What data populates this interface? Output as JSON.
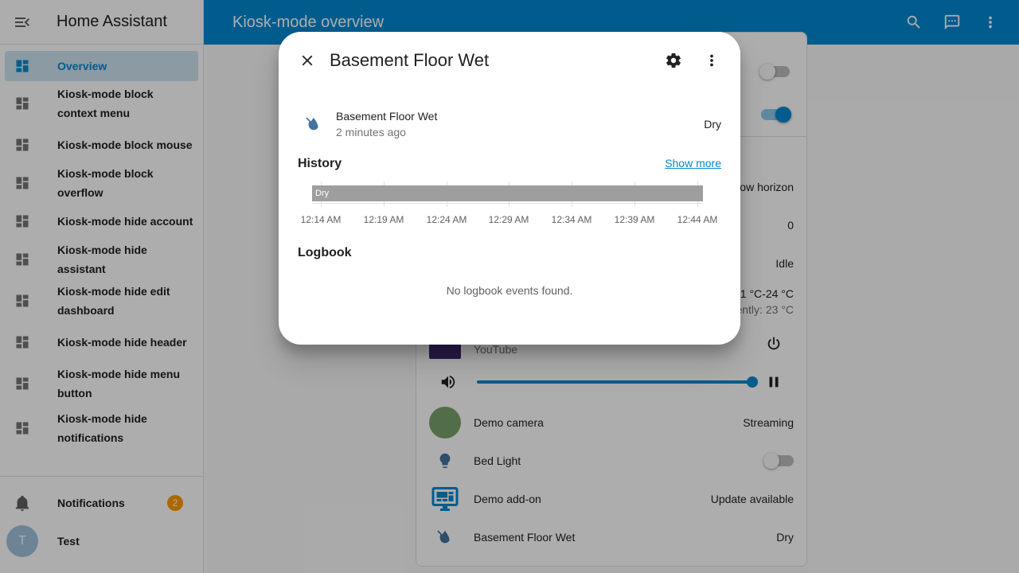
{
  "sidebar": {
    "title": "Home Assistant",
    "items": [
      {
        "label": "Overview",
        "active": true
      },
      {
        "label": "Kiosk-mode block context menu"
      },
      {
        "label": "Kiosk-mode block mouse"
      },
      {
        "label": "Kiosk-mode block overflow"
      },
      {
        "label": "Kiosk-mode hide account"
      },
      {
        "label": "Kiosk-mode hide assistant"
      },
      {
        "label": "Kiosk-mode hide edit dashboard"
      },
      {
        "label": "Kiosk-mode hide header"
      },
      {
        "label": "Kiosk-mode hide menu button"
      },
      {
        "label": "Kiosk-mode hide notifications"
      }
    ],
    "notifications_label": "Notifications",
    "notifications_count": "2",
    "user_initial": "T",
    "user_name": "Test"
  },
  "topbar": {
    "title": "Kiosk-mode overview",
    "icons": [
      "search-icon",
      "assist-icon",
      "more-vert-icon"
    ]
  },
  "card": {
    "partial_row_1": "ow horizon",
    "partial_row_2_value": "0",
    "partial_row_3_value": "Idle",
    "climate_range": "21 °C-24 °C",
    "climate_current": "ently: 23 °C",
    "media_source": "YouTube",
    "camera_label": "Demo camera",
    "camera_state": "Streaming",
    "bed_light_label": "Bed Light",
    "addon_label": "Demo add-on",
    "addon_state": "Update available",
    "sensor_label": "Basement Floor Wet",
    "sensor_state": "Dry"
  },
  "dialog": {
    "title": "Basement Floor Wet",
    "entity_name": "Basement Floor Wet",
    "last_changed": "2 minutes ago",
    "state": "Dry",
    "history_title": "History",
    "show_more": "Show more",
    "timeline_state": "Dry",
    "ticks": [
      "12:14 AM",
      "12:19 AM",
      "12:24 AM",
      "12:29 AM",
      "12:34 AM",
      "12:39 AM",
      "12:44 AM"
    ],
    "logbook_title": "Logbook",
    "logbook_empty": "No logbook events found."
  },
  "colors": {
    "primary": "#0288d1",
    "badge": "#ff9800",
    "timeline_dry": "#9e9e9e"
  }
}
